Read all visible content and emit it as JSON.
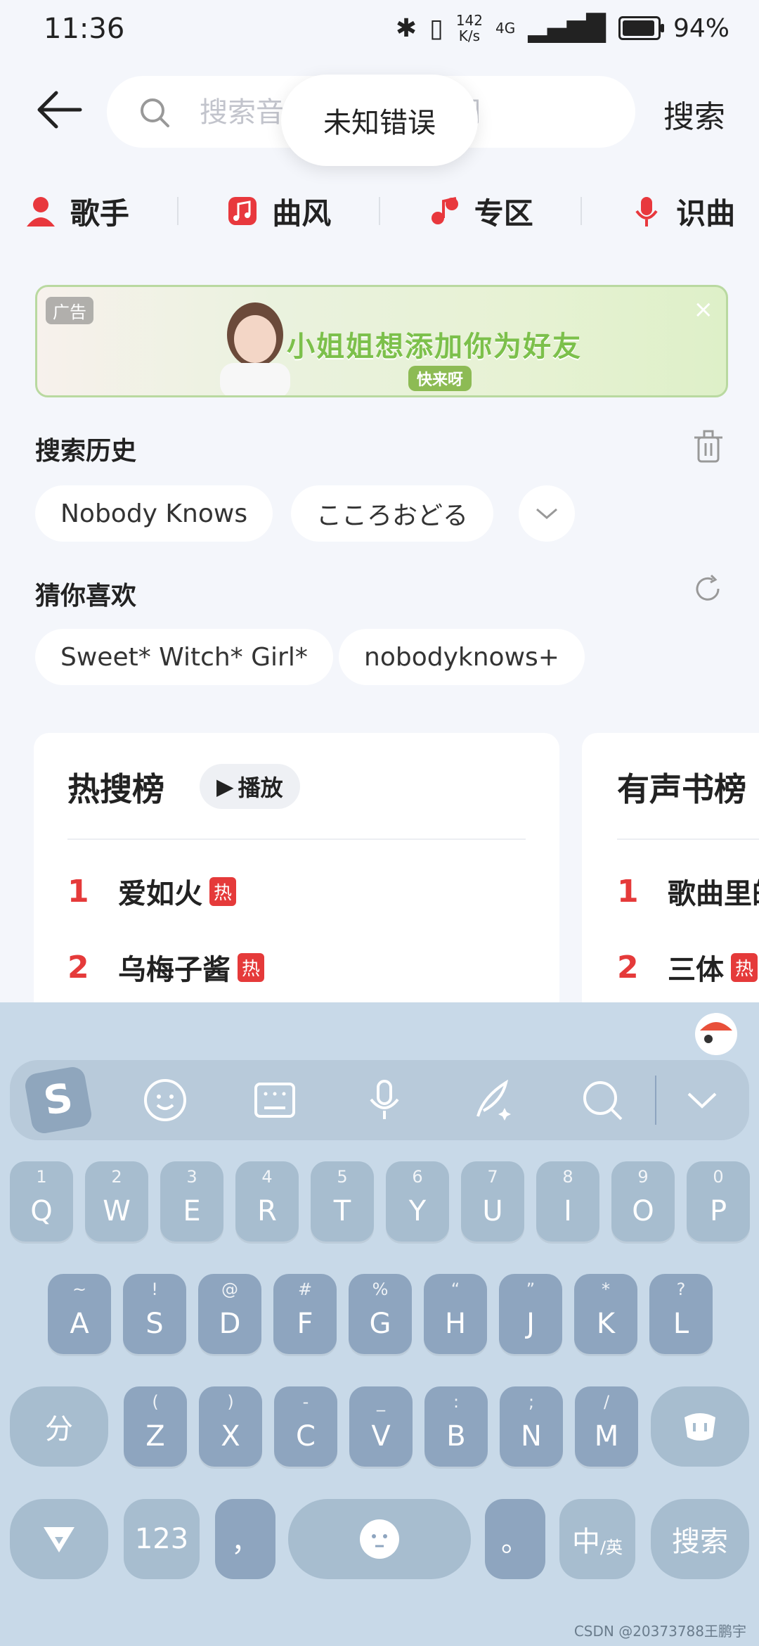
{
  "status_bar": {
    "time": "11:36",
    "net_speed": "142",
    "net_unit": "K/s",
    "signal": "4G",
    "battery": "94%",
    "battery_level": 0.94
  },
  "search": {
    "placeholder": "搜索音乐、播客、歌词",
    "button": "搜索",
    "toast": "未知错误"
  },
  "categories": [
    {
      "label": "歌手",
      "icon": "singer-icon"
    },
    {
      "label": "曲风",
      "icon": "music-note-icon"
    },
    {
      "label": "专区",
      "icon": "zone-icon"
    },
    {
      "label": "识曲",
      "icon": "mic-icon"
    }
  ],
  "ad": {
    "tag": "广告",
    "title": "小姐姐想添加你为好友",
    "subtitle": "快来呀",
    "close": "×"
  },
  "history": {
    "title": "搜索历史",
    "chips": [
      "Nobody Knows",
      "こころおどる"
    ]
  },
  "recommend": {
    "title": "猜你喜欢",
    "chips": [
      "Sweet* Witch* Girl*",
      "nobodyknows+"
    ]
  },
  "hot_card": {
    "title": "热搜榜",
    "play": "播放",
    "items": [
      {
        "rank": "1",
        "name": "爱如火",
        "badge": "热"
      },
      {
        "rank": "2",
        "name": "乌梅子酱",
        "badge": "热"
      }
    ]
  },
  "audiobook_card": {
    "title": "有声书榜",
    "items": [
      {
        "rank": "1",
        "name": "歌曲里的"
      },
      {
        "rank": "2",
        "name": "三体",
        "badge": "热"
      }
    ]
  },
  "keyboard": {
    "row1": [
      {
        "k": "Q",
        "s": "1"
      },
      {
        "k": "W",
        "s": "2"
      },
      {
        "k": "E",
        "s": "3"
      },
      {
        "k": "R",
        "s": "4"
      },
      {
        "k": "T",
        "s": "5"
      },
      {
        "k": "Y",
        "s": "6"
      },
      {
        "k": "U",
        "s": "7"
      },
      {
        "k": "I",
        "s": "8"
      },
      {
        "k": "O",
        "s": "9"
      },
      {
        "k": "P",
        "s": "0"
      }
    ],
    "row2": [
      {
        "k": "A",
        "s": "~"
      },
      {
        "k": "S",
        "s": "!"
      },
      {
        "k": "D",
        "s": "@"
      },
      {
        "k": "F",
        "s": "#"
      },
      {
        "k": "G",
        "s": "%"
      },
      {
        "k": "H",
        "s": "“"
      },
      {
        "k": "J",
        "s": "”"
      },
      {
        "k": "K",
        "s": "*"
      },
      {
        "k": "L",
        "s": "?"
      }
    ],
    "row3": [
      {
        "k": "Z",
        "s": "("
      },
      {
        "k": "X",
        "s": ")"
      },
      {
        "k": "C",
        "s": "-"
      },
      {
        "k": "V",
        "s": "_"
      },
      {
        "k": "B",
        "s": ":"
      },
      {
        "k": "N",
        "s": ";"
      },
      {
        "k": "M",
        "s": "/"
      }
    ],
    "split_key": "分",
    "num_key": "123",
    "comma_key": "，",
    "period_key": "。",
    "lang_key_main": "中",
    "lang_key_sub": "/英",
    "search_key": "搜索"
  },
  "watermark": "CSDN @20373788王鹏宇"
}
